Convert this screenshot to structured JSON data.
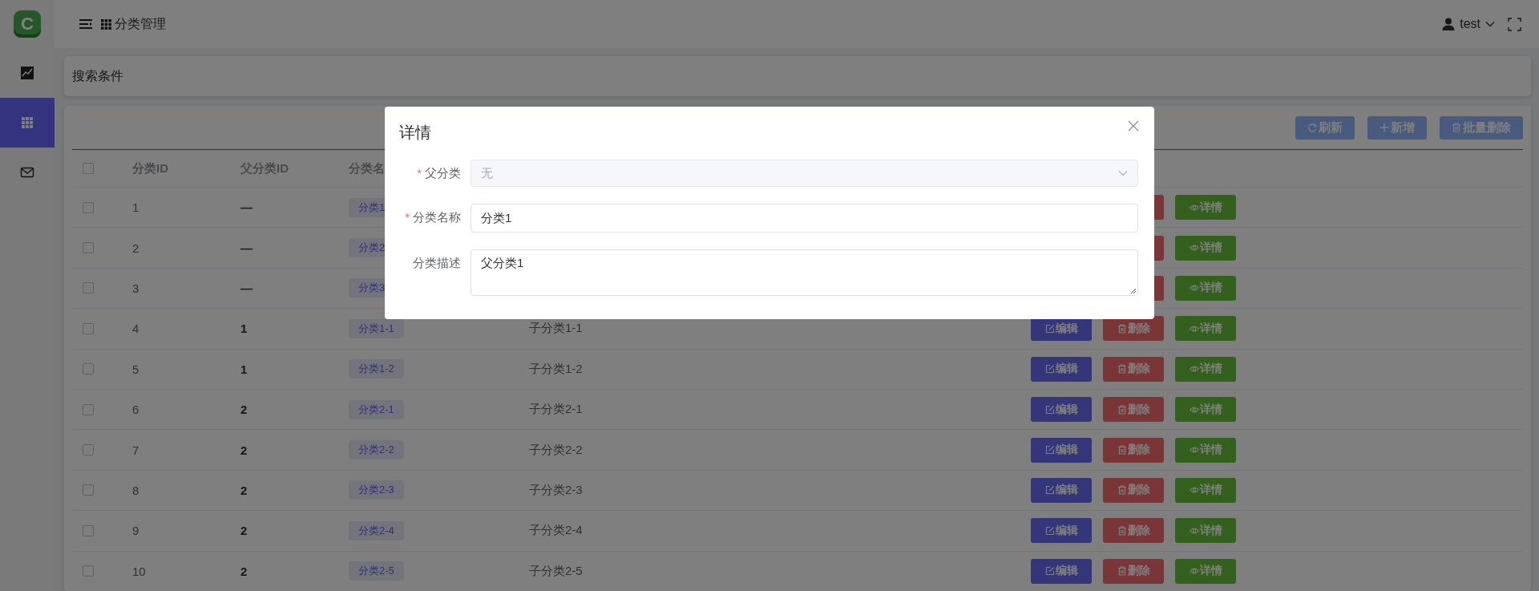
{
  "sidebar": {
    "logo": "C",
    "items": [
      {
        "kind": "chart",
        "selected": false
      },
      {
        "kind": "grid",
        "selected": true
      },
      {
        "kind": "mail",
        "selected": false
      }
    ]
  },
  "header": {
    "title": "分类管理",
    "user": "test"
  },
  "search_panel": {
    "title": "搜索条件"
  },
  "toolbar": [
    {
      "kind": "refresh",
      "label": "刷新"
    },
    {
      "kind": "add",
      "label": "新增"
    },
    {
      "kind": "batch_delete",
      "label": "批量删除"
    }
  ],
  "table": {
    "select_all": {
      "checked": false
    },
    "columns": [
      "分类ID",
      "父分类ID",
      "分类名"
    ],
    "rows": [
      {
        "checked": false,
        "id": "1",
        "parent_id": "—",
        "name": "分类1",
        "actions": [
          {
            "kind": "delete"
          },
          {
            "kind": "detail",
            "label": "详情"
          }
        ]
      },
      {
        "checked": false,
        "id": "2",
        "parent_id": "—",
        "name": "分类2",
        "actions": [
          {
            "kind": "delete"
          },
          {
            "kind": "detail",
            "label": "详情"
          }
        ]
      },
      {
        "checked": false,
        "id": "3",
        "parent_id": "—",
        "name": "分类3",
        "actions": [
          {
            "kind": "delete"
          },
          {
            "kind": "detail",
            "label": "详情"
          }
        ]
      },
      {
        "checked": false,
        "id": "4",
        "parent_id": "1",
        "name": "分类1-1",
        "description": "子分类1-1",
        "actions": [
          {
            "kind": "edit",
            "label": "编辑"
          },
          {
            "kind": "delete",
            "label": "删除"
          },
          {
            "kind": "detail",
            "label": "详情"
          }
        ]
      },
      {
        "checked": false,
        "id": "5",
        "parent_id": "1",
        "name": "分类1-2",
        "description": "子分类1-2",
        "actions": [
          {
            "kind": "edit",
            "label": "编辑"
          },
          {
            "kind": "delete",
            "label": "删除"
          },
          {
            "kind": "detail",
            "label": "详情"
          }
        ]
      },
      {
        "checked": false,
        "id": "6",
        "parent_id": "2",
        "name": "分类2-1",
        "description": "子分类2-1",
        "actions": [
          {
            "kind": "edit",
            "label": "编辑"
          },
          {
            "kind": "delete",
            "label": "删除"
          },
          {
            "kind": "detail",
            "label": "详情"
          }
        ]
      },
      {
        "checked": false,
        "id": "7",
        "parent_id": "2",
        "name": "分类2-2",
        "description": "子分类2-2",
        "actions": [
          {
            "kind": "edit",
            "label": "编辑"
          },
          {
            "kind": "delete",
            "label": "删除"
          },
          {
            "kind": "detail",
            "label": "详情"
          }
        ]
      },
      {
        "checked": false,
        "id": "8",
        "parent_id": "2",
        "name": "分类2-3",
        "description": "子分类2-3",
        "actions": [
          {
            "kind": "edit",
            "label": "编辑"
          },
          {
            "kind": "delete",
            "label": "删除"
          },
          {
            "kind": "detail",
            "label": "详情"
          }
        ]
      },
      {
        "checked": false,
        "id": "9",
        "parent_id": "2",
        "name": "分类2-4",
        "description": "子分类2-4",
        "actions": [
          {
            "kind": "edit",
            "label": "编辑"
          },
          {
            "kind": "delete",
            "label": "删除"
          },
          {
            "kind": "detail",
            "label": "详情"
          }
        ]
      },
      {
        "checked": false,
        "id": "10",
        "parent_id": "2",
        "name": "分类2-5",
        "description": "子分类2-5",
        "actions": [
          {
            "kind": "edit",
            "label": "编辑"
          },
          {
            "kind": "delete",
            "label": "删除"
          },
          {
            "kind": "detail",
            "label": "详情"
          }
        ]
      }
    ]
  },
  "dialog": {
    "title": "详情",
    "fields": [
      {
        "kind": "select",
        "required_mark": "*",
        "label": "父分类",
        "disabled": true,
        "value": "无"
      },
      {
        "kind": "input",
        "required_mark": "*",
        "label": "分类名称",
        "disabled": false,
        "value": "分类1"
      },
      {
        "kind": "textarea",
        "label": "分类描述",
        "disabled": false,
        "value": "父分类1"
      }
    ]
  }
}
